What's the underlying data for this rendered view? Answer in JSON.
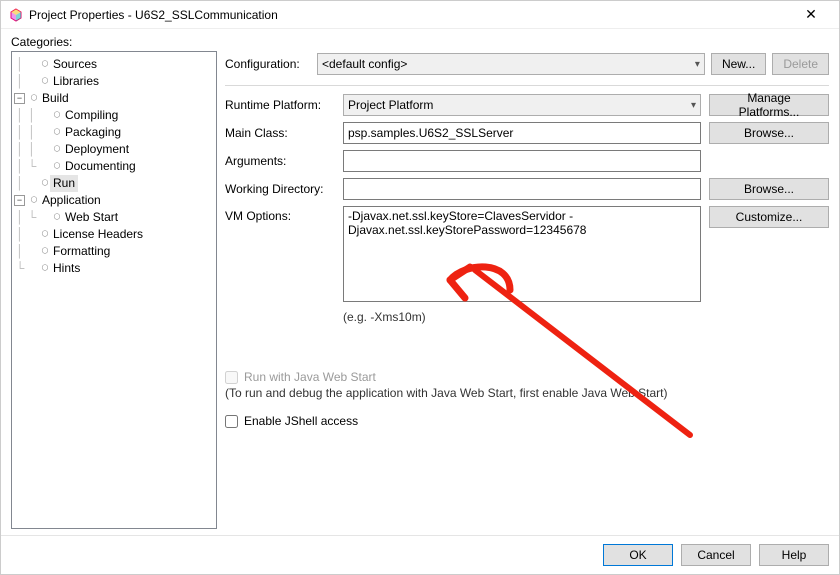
{
  "window": {
    "title": "Project Properties - U6S2_SSLCommunication"
  },
  "sidebar": {
    "heading": "Categories:",
    "items": [
      {
        "label": "Sources",
        "depth": 1
      },
      {
        "label": "Libraries",
        "depth": 1
      },
      {
        "label": "Build",
        "depth": 1,
        "expandable": true
      },
      {
        "label": "Compiling",
        "depth": 2
      },
      {
        "label": "Packaging",
        "depth": 2
      },
      {
        "label": "Deployment",
        "depth": 2
      },
      {
        "label": "Documenting",
        "depth": 2
      },
      {
        "label": "Run",
        "depth": 1,
        "selected": true
      },
      {
        "label": "Application",
        "depth": 1,
        "expandable": true
      },
      {
        "label": "Web Start",
        "depth": 2
      },
      {
        "label": "License Headers",
        "depth": 1
      },
      {
        "label": "Formatting",
        "depth": 1
      },
      {
        "label": "Hints",
        "depth": 1
      }
    ]
  },
  "config": {
    "label": "Configuration:",
    "selected": "<default config>",
    "newBtn": "New...",
    "deleteBtn": "Delete"
  },
  "form": {
    "runtimePlatformLabel": "Runtime Platform:",
    "runtimePlatformValue": "Project Platform",
    "managePlatforms": "Manage Platforms...",
    "mainClassLabel": "Main Class:",
    "mainClassValue": "psp.samples.U6S2_SSLServer",
    "browse": "Browse...",
    "argumentsLabel": "Arguments:",
    "argumentsValue": "",
    "workingDirLabel": "Working Directory:",
    "workingDirValue": "",
    "vmOptionsLabel": "VM Options:",
    "vmOptionsValue": "-Djavax.net.ssl.keyStore=ClavesServidor -Djavax.net.ssl.keyStorePassword=12345678",
    "customize": "Customize...",
    "vmHint": "(e.g. -Xms10m)"
  },
  "lower": {
    "runWebStart": "Run with Java Web Start",
    "runWebStartHint": "(To run and debug the application with Java Web Start, first enable Java Web Start)",
    "enableJShell": "Enable JShell access"
  },
  "buttons": {
    "ok": "OK",
    "cancel": "Cancel",
    "help": "Help"
  }
}
